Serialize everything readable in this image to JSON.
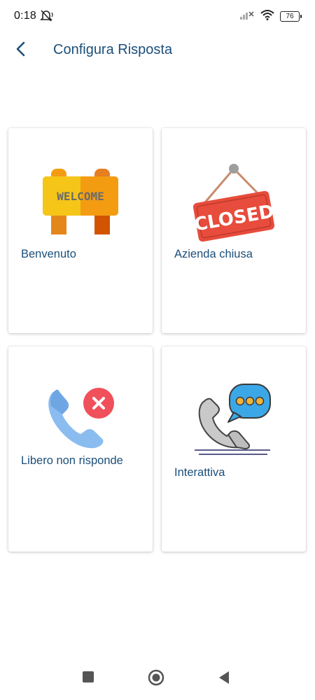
{
  "status_bar": {
    "time": "0:18",
    "battery": "76",
    "icons": [
      "muted-bell-icon",
      "signal-off-icon",
      "wifi-icon",
      "battery-icon"
    ]
  },
  "header": {
    "title": "Configura Risposta",
    "back_icon": "chevron-left-icon"
  },
  "cards": [
    {
      "label": "Benvenuto",
      "icon": "welcome-sign-icon",
      "art_text": "WELCOME"
    },
    {
      "label": "Azienda chiusa",
      "icon": "closed-sign-icon",
      "art_text": "CLOSED"
    },
    {
      "label": "Libero non risponde",
      "icon": "phone-declined-icon"
    },
    {
      "label": "Interattiva",
      "icon": "phone-chat-icon"
    }
  ],
  "nav_bar": {
    "items": [
      "recents-square-icon",
      "home-circle-icon",
      "back-triangle-icon"
    ]
  },
  "colors": {
    "title": "#1b4f7a",
    "welcome_yellow": "#f5c518",
    "welcome_orange": "#f39c12",
    "closed_red": "#e74c3c",
    "phone_blue": "#7fb3ea",
    "chat_blue": "#3ba7e6"
  }
}
